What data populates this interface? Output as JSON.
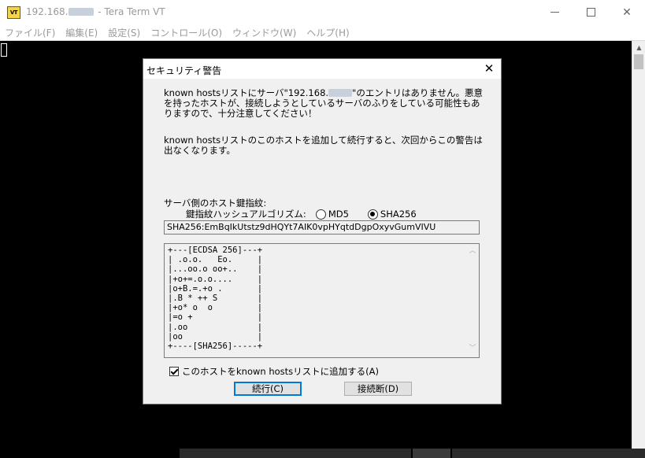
{
  "window": {
    "title_ip_prefix": "192.168.",
    "title_suffix": " - Tera Term VT",
    "icon_text": "VT"
  },
  "menu": [
    {
      "label": "ファイル(F)"
    },
    {
      "label": "編集(E)"
    },
    {
      "label": "設定(S)"
    },
    {
      "label": "コントロール(O)"
    },
    {
      "label": "ウィンドウ(W)"
    },
    {
      "label": "ヘルプ(H)"
    }
  ],
  "dialog": {
    "title": "セキュリティ警告",
    "message1_a": "known hostsリストにサーバ\"192.168.",
    "message1_b": "\"のエントリはありません。悪意を持ったホストが、接続しようとしているサーバのふりをしている可能性もありますので、十分注意してください！",
    "message2": "known hostsリストのこのホストを追加して続行すると、次回からこの警告は出なくなります。",
    "fingerprint_label": "サーバ側のホスト鍵指紋:",
    "algorithm_label": "鍵指紋ハッシュアルゴリズム:",
    "algorithms": [
      {
        "label": "MD5",
        "selected": false
      },
      {
        "label": "SHA256",
        "selected": true
      }
    ],
    "fingerprint_value": "SHA256:EmBqIkUtstz9dHQYt7AIK0vpHYqtdDgpOxyvGumVIVU",
    "randomart": "+---[ECDSA 256]---+\n| .o.o.   Eo.     |\n|...oo.o oo+..    |\n|+o+=.o.o....     |\n|o+B.=.+o .       |\n|.B * ++ S        |\n|+o* o  o         |\n|=o +             |\n|.oo              |\n|oo               |\n+----[SHA256]-----+",
    "add_checkbox_label": "このホストをknown hostsリストに追加する(A)",
    "add_checked": true,
    "continue_label": "続行(C)",
    "disconnect_label": "接続断(D)"
  },
  "colors": {
    "terminal_bg": "#000000",
    "dialog_bg": "#f0f0f0",
    "focus_border": "#0078d7"
  }
}
